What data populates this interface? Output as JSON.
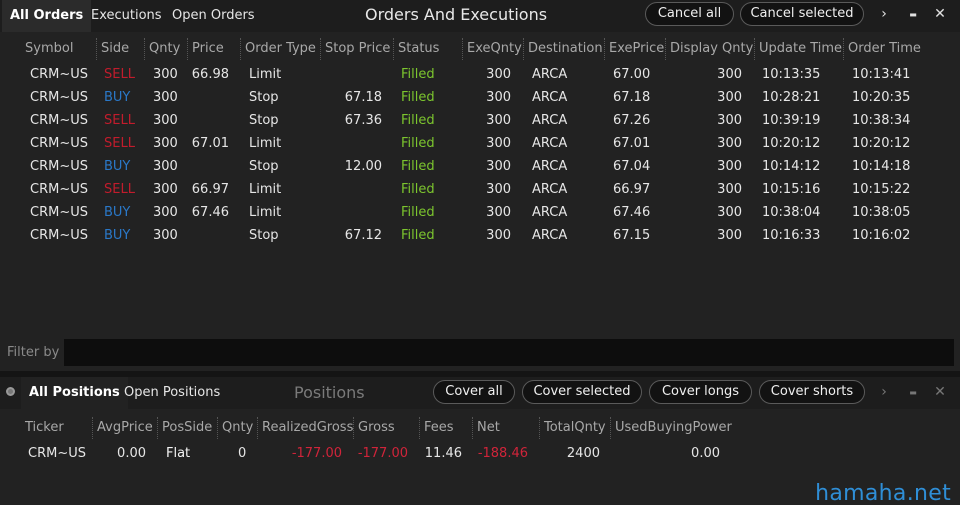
{
  "orders_panel": {
    "tabs": [
      "All Orders",
      "Executions",
      "Open Orders"
    ],
    "title": "Orders And Executions",
    "buttons": {
      "cancel_all": "Cancel all",
      "cancel_selected": "Cancel selected"
    },
    "icons": {
      "more": "›",
      "minimize": "▬",
      "close": "✕"
    },
    "columns": [
      "Symbol",
      "Side",
      "Qnty",
      "Price",
      "Order Type",
      "Stop Price",
      "Status",
      "ExeQnty",
      "Destination",
      "ExePrice",
      "Display Qnty",
      "Update Time",
      "Order Time"
    ],
    "rows": [
      {
        "symbol": "CRM~US",
        "side": "SELL",
        "qnty": "300",
        "price": "66.98",
        "order_type": "Limit",
        "stop_price": "",
        "status": "Filled",
        "exe_qnty": "300",
        "destination": "ARCA",
        "exe_price": "67.00",
        "display_qnty": "300",
        "update_time": "10:13:35",
        "order_time": "10:13:41"
      },
      {
        "symbol": "CRM~US",
        "side": "BUY",
        "qnty": "300",
        "price": "",
        "order_type": "Stop",
        "stop_price": "67.18",
        "status": "Filled",
        "exe_qnty": "300",
        "destination": "ARCA",
        "exe_price": "67.18",
        "display_qnty": "300",
        "update_time": "10:28:21",
        "order_time": "10:20:35"
      },
      {
        "symbol": "CRM~US",
        "side": "SELL",
        "qnty": "300",
        "price": "",
        "order_type": "Stop",
        "stop_price": "67.36",
        "status": "Filled",
        "exe_qnty": "300",
        "destination": "ARCA",
        "exe_price": "67.26",
        "display_qnty": "300",
        "update_time": "10:39:19",
        "order_time": "10:38:34"
      },
      {
        "symbol": "CRM~US",
        "side": "SELL",
        "qnty": "300",
        "price": "67.01",
        "order_type": "Limit",
        "stop_price": "",
        "status": "Filled",
        "exe_qnty": "300",
        "destination": "ARCA",
        "exe_price": "67.01",
        "display_qnty": "300",
        "update_time": "10:20:12",
        "order_time": "10:20:12"
      },
      {
        "symbol": "CRM~US",
        "side": "BUY",
        "qnty": "300",
        "price": "",
        "order_type": "Stop",
        "stop_price": "12.00",
        "status": "Filled",
        "exe_qnty": "300",
        "destination": "ARCA",
        "exe_price": "67.04",
        "display_qnty": "300",
        "update_time": "10:14:12",
        "order_time": "10:14:18"
      },
      {
        "symbol": "CRM~US",
        "side": "SELL",
        "qnty": "300",
        "price": "66.97",
        "order_type": "Limit",
        "stop_price": "",
        "status": "Filled",
        "exe_qnty": "300",
        "destination": "ARCA",
        "exe_price": "66.97",
        "display_qnty": "300",
        "update_time": "10:15:16",
        "order_time": "10:15:22"
      },
      {
        "symbol": "CRM~US",
        "side": "BUY",
        "qnty": "300",
        "price": "67.46",
        "order_type": "Limit",
        "stop_price": "",
        "status": "Filled",
        "exe_qnty": "300",
        "destination": "ARCA",
        "exe_price": "67.46",
        "display_qnty": "300",
        "update_time": "10:38:04",
        "order_time": "10:38:05"
      },
      {
        "symbol": "CRM~US",
        "side": "BUY",
        "qnty": "300",
        "price": "",
        "order_type": "Stop",
        "stop_price": "67.12",
        "status": "Filled",
        "exe_qnty": "300",
        "destination": "ARCA",
        "exe_price": "67.15",
        "display_qnty": "300",
        "update_time": "10:16:33",
        "order_time": "10:16:02"
      }
    ],
    "filter": {
      "label": "Filter by",
      "value": ""
    }
  },
  "positions_panel": {
    "tabs": [
      "All Positions",
      "Open Positions"
    ],
    "title": "Positions",
    "buttons": {
      "cover_all": "Cover all",
      "cover_selected": "Cover selected",
      "cover_longs": "Cover longs",
      "cover_shorts": "Cover shorts"
    },
    "icons": {
      "more": "›",
      "minimize": "▬",
      "close": "✕"
    },
    "columns": [
      "Ticker",
      "AvgPrice",
      "PosSide",
      "Qnty",
      "RealizedGross",
      "Gross",
      "Fees",
      "Net",
      "TotalQnty",
      "UsedBuyingPower"
    ],
    "row": {
      "ticker": "CRM~US",
      "avg_price": "0.00",
      "pos_side": "Flat",
      "qnty": "0",
      "realized_gross": "-177.00",
      "gross": "-177.00",
      "fees": "11.46",
      "net": "-188.46",
      "total_qnty": "2400",
      "used_buying_power": "0.00"
    }
  },
  "watermark": "hamaha.net",
  "colors": {
    "sell": "#c21c2c",
    "buy": "#2a78c8",
    "filled": "#7cc52e",
    "negative": "#d0243a",
    "watermark": "#2f8ed6"
  }
}
